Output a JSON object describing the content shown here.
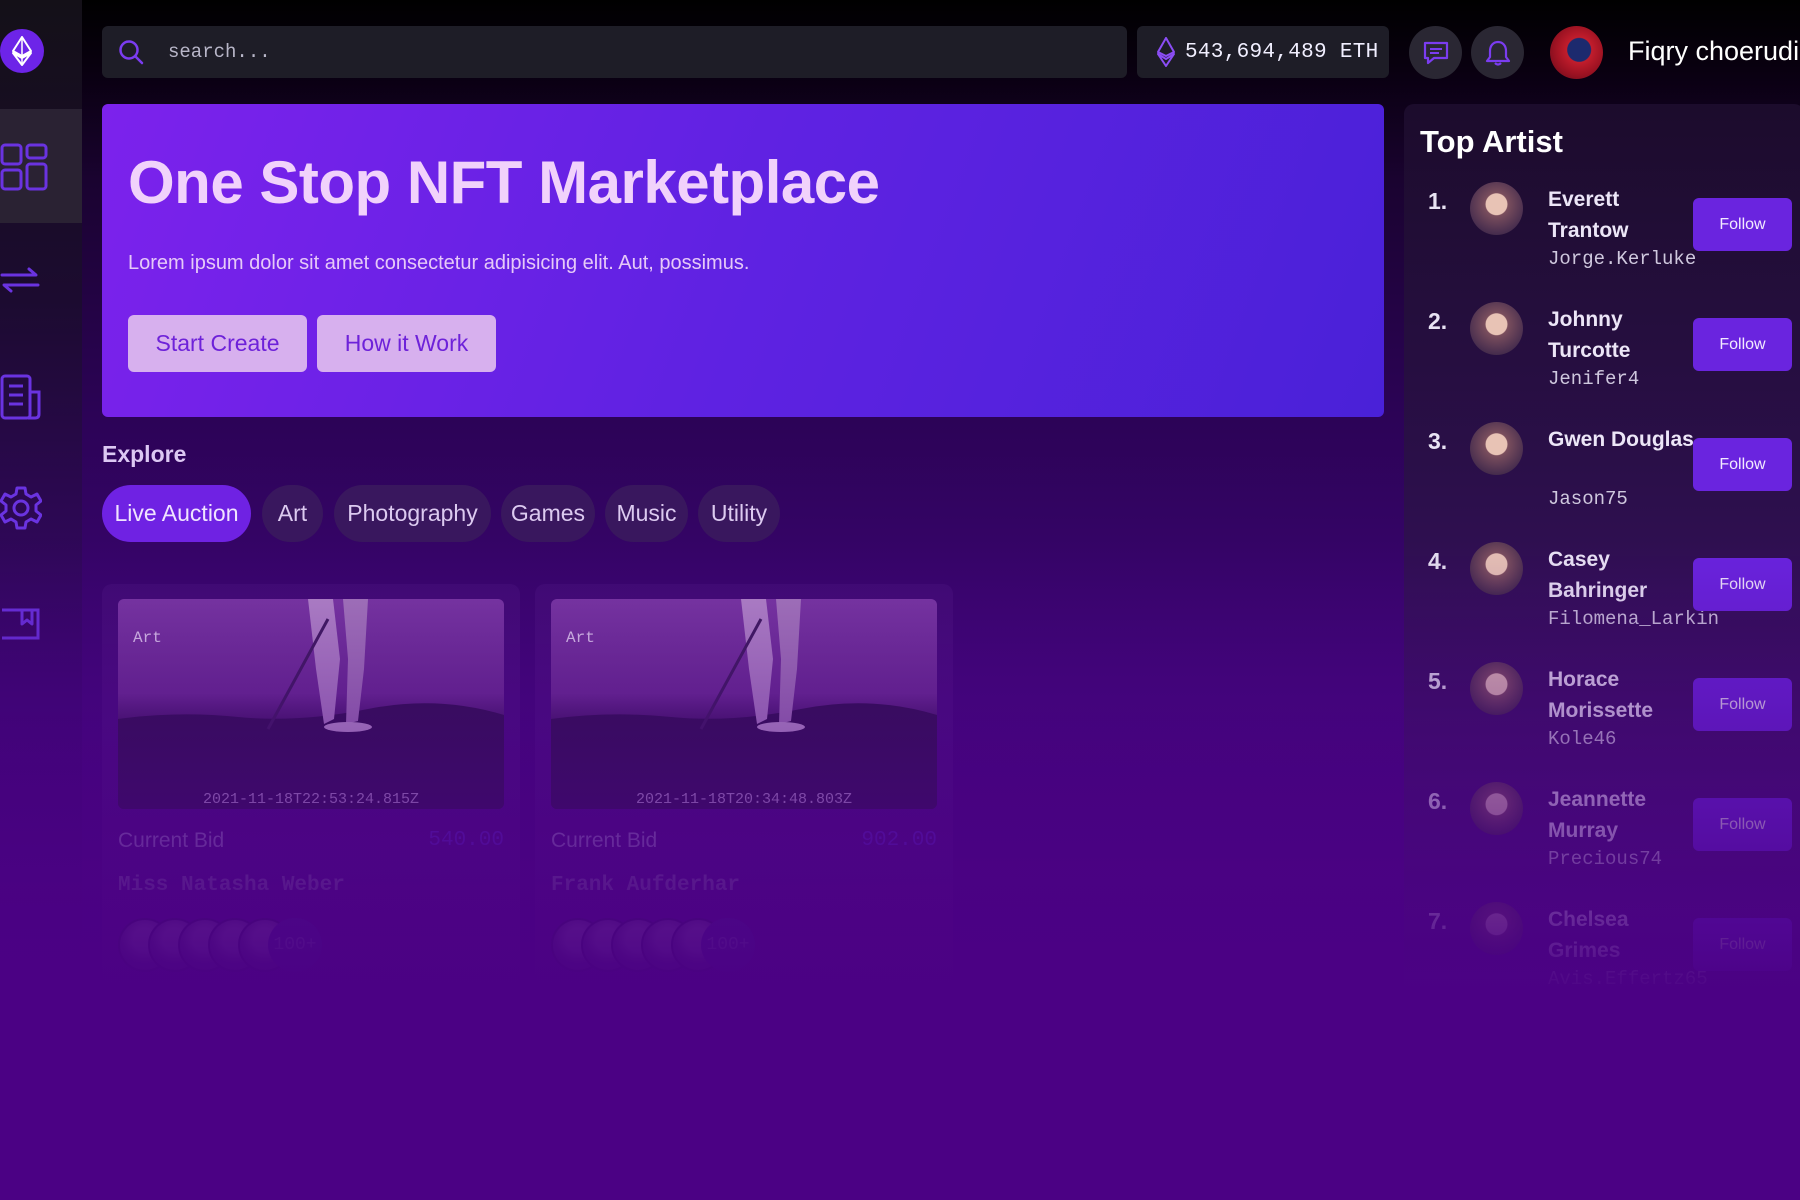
{
  "search": {
    "placeholder": "search..."
  },
  "balance": {
    "value": "543,694,489 ETH"
  },
  "user": {
    "name": "Fiqry choerudin"
  },
  "hero": {
    "title": "One Stop NFT Marketplace",
    "description": "Lorem ipsum dolor sit amet consectetur adipisicing elit. Aut, possimus.",
    "start_label": "Start Create",
    "how_label": "How it Work"
  },
  "explore": {
    "title": "Explore",
    "chips": [
      "Live Auction",
      "Art",
      "Photography",
      "Games",
      "Music",
      "Utility"
    ]
  },
  "cards": [
    {
      "tag": "Art",
      "date": "2021-11-18T22:53:24.815Z",
      "bid_label": "Current Bid",
      "bid": "540.00",
      "name": "Miss Natasha Weber",
      "bidders": "100+"
    },
    {
      "tag": "Art",
      "date": "2021-11-18T20:34:48.803Z",
      "bid_label": "Current Bid",
      "bid": "902.00",
      "name": "Frank Aufderhar",
      "bidders": "100+"
    }
  ],
  "top_artist": {
    "title": "Top Artist",
    "follow_label": "Follow",
    "items": [
      {
        "rank": "1.",
        "name": "Everett Trantow",
        "handle": "Jorge.Kerluke"
      },
      {
        "rank": "2.",
        "name": "Johnny Turcotte",
        "handle": "Jenifer4"
      },
      {
        "rank": "3.",
        "name": "Gwen Douglas",
        "handle": "Jason75"
      },
      {
        "rank": "4.",
        "name": "Casey Bahringer",
        "handle": "Filomena_Larkin"
      },
      {
        "rank": "5.",
        "name": "Horace Morissette",
        "handle": "Kole46"
      },
      {
        "rank": "6.",
        "name": "Jeannette Murray",
        "handle": "Precious74"
      },
      {
        "rank": "7.",
        "name": "Chelsea Grimes",
        "handle": "Avis.Effertz65"
      }
    ]
  },
  "colors": {
    "accent": "#6f22e3",
    "background": "#4b0184",
    "hero_start": "#7c22ec",
    "hero_end": "#4a21d8"
  }
}
